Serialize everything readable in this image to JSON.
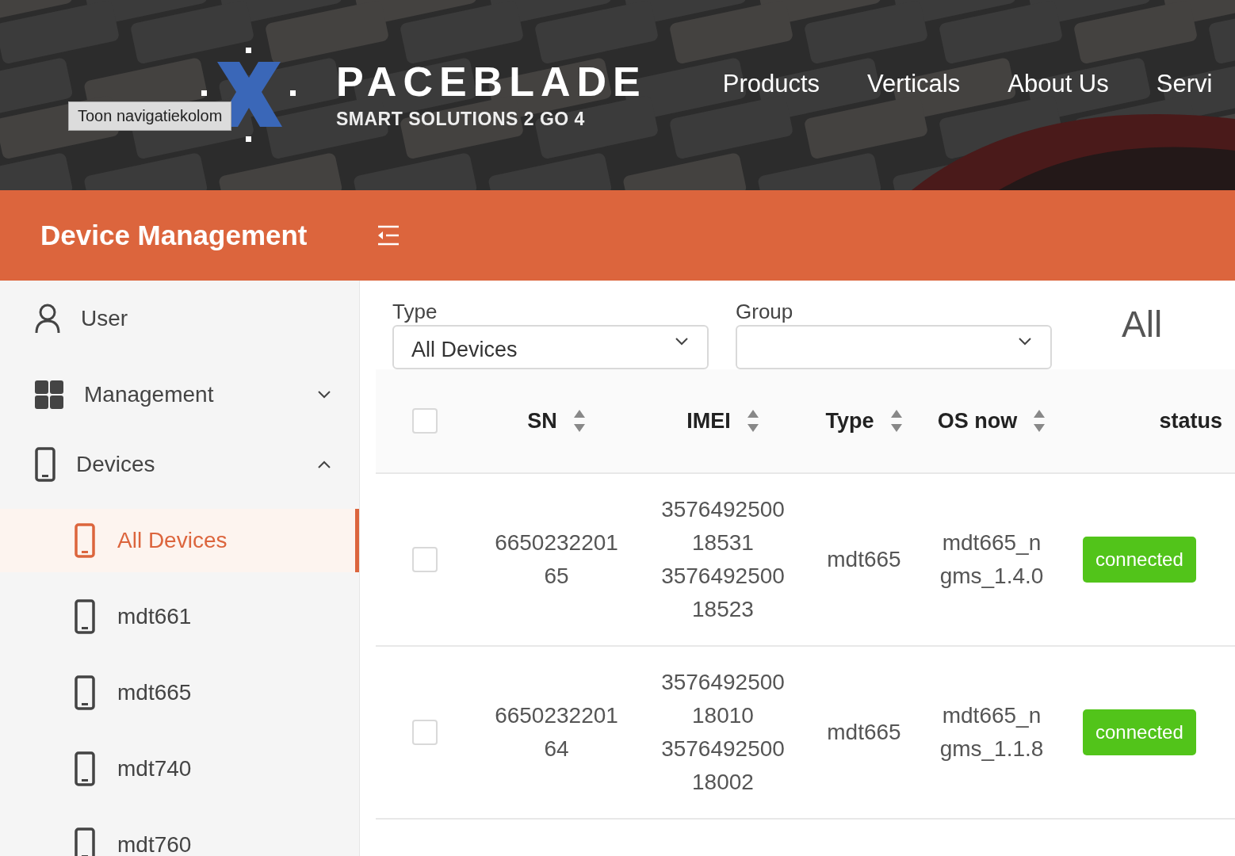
{
  "header": {
    "logo": {
      "name": "PACEBLADE",
      "tagline": "SMART SOLUTIONS 2 GO 4"
    },
    "nav": [
      "Products",
      "Verticals",
      "About Us",
      "Servi"
    ],
    "tooltip": "Toon navigatiekolom"
  },
  "app_bar": {
    "title": "Device Management"
  },
  "sidebar": {
    "items": [
      {
        "label": "User",
        "kind": "user"
      },
      {
        "label": "Management",
        "kind": "grid",
        "expanded": false
      },
      {
        "label": "Devices",
        "kind": "device",
        "expanded": true,
        "children": [
          {
            "label": "All Devices",
            "selected": true
          },
          {
            "label": "mdt661",
            "selected": false
          },
          {
            "label": "mdt665",
            "selected": false
          },
          {
            "label": "mdt740",
            "selected": false
          },
          {
            "label": "mdt760",
            "selected": false
          }
        ]
      }
    ]
  },
  "filters": [
    {
      "label": "Type",
      "value": "All Devices"
    },
    {
      "label": "Group"
    }
  ],
  "summary": "All",
  "table": {
    "select_all": {
      "checked": false
    },
    "columns": [
      {
        "label": "SN",
        "sortable": true
      },
      {
        "label": "IMEI",
        "sortable": true
      },
      {
        "label": "Type",
        "sortable": true
      },
      {
        "label": "OS now",
        "sortable": true
      },
      {
        "label": "status",
        "sortable": false
      }
    ],
    "rows": [
      {
        "checked": false,
        "sn": [
          "6650232201",
          "65"
        ],
        "imei": [
          "3576492500",
          "18531",
          "3576492500",
          "18523"
        ],
        "type": "mdt665",
        "os": [
          "mdt665_n",
          "gms_1.4.0"
        ],
        "status": "connected"
      },
      {
        "checked": false,
        "sn": [
          "6650232201",
          "64"
        ],
        "imei": [
          "3576492500",
          "18010",
          "3576492500",
          "18002"
        ],
        "type": "mdt665",
        "os": [
          "mdt665_n",
          "gms_1.1.8"
        ],
        "status": "connected"
      }
    ]
  }
}
